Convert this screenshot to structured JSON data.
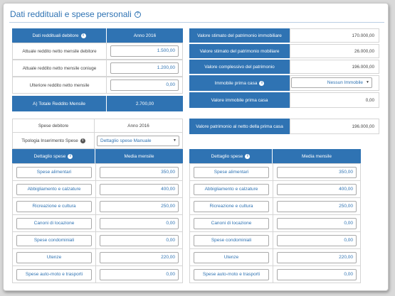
{
  "title": "Dati reddituali e spese personali",
  "help_icon": "?",
  "income": {
    "header_label": "Dati reddituali debitore",
    "header_year": "Anno 2016",
    "rows": [
      {
        "label": "Attuale reddito netto mensile debitore",
        "value": "1.500,00"
      },
      {
        "label": "Attuale reddito netto mensile coniuge",
        "value": "1.200,00"
      },
      {
        "label": "Ulteriore reddito netto mensile",
        "value": "0,00"
      }
    ],
    "total_label": "A) Totale Reddito Mensile",
    "total_value": "2.700,00"
  },
  "assets": {
    "rows": [
      {
        "label": "Valore stimato del patrimonio immobiliare",
        "value": "170.000,00"
      },
      {
        "label": "Valore stimato del patrimonio mobiliare",
        "value": "26.000,00"
      },
      {
        "label": "Valore complessivo del patrimonio",
        "value": "196.000,00"
      }
    ],
    "primary_home_label": "Immobile prima casa",
    "primary_home_select": "Nessun Immobile",
    "primary_home_value_label": "Valore immobile prima casa",
    "primary_home_value": "0,00",
    "net_label": "Valore patrimonio al netto della prima casa",
    "net_value": "196.000,00"
  },
  "expenses": {
    "header_label": "Spese debitore",
    "header_year": "Anno 2016",
    "type_label": "Tipologia Inserimento Spese",
    "type_select": "Dettaglio spese Manuale",
    "detail_header": "Dettaglio spese",
    "avg_header": "Media mensile",
    "left": [
      {
        "label": "Spese alimentari",
        "value": "350,00"
      },
      {
        "label": "Abbigliamento e calzature",
        "value": "400,00"
      },
      {
        "label": "Ricreazione e cultura",
        "value": "250,00"
      },
      {
        "label": "Canoni di locazione",
        "value": "0,00"
      },
      {
        "label": "Spese condominiali",
        "value": "0,00"
      },
      {
        "label": "Utenze",
        "value": "220,00"
      },
      {
        "label": "Spese auto-moto e trasporti",
        "value": "0,00"
      }
    ],
    "right": [
      {
        "label": "Spese alimentari",
        "value": "350,00"
      },
      {
        "label": "Abbigliamento e calzature",
        "value": "400,00"
      },
      {
        "label": "Ricreazione e cultura",
        "value": "250,00"
      },
      {
        "label": "Canoni di locazione",
        "value": "0,00"
      },
      {
        "label": "Spese condominiali",
        "value": "0,00"
      },
      {
        "label": "Utenze",
        "value": "220,00"
      },
      {
        "label": "Spese auto-moto e trasporti",
        "value": "0,00"
      }
    ]
  },
  "colors": {
    "accent": "#2f73b3",
    "border": "#d5d5d5"
  },
  "icons": {
    "info": "info-icon",
    "help": "help-icon",
    "caret": "chevron-down-icon"
  }
}
